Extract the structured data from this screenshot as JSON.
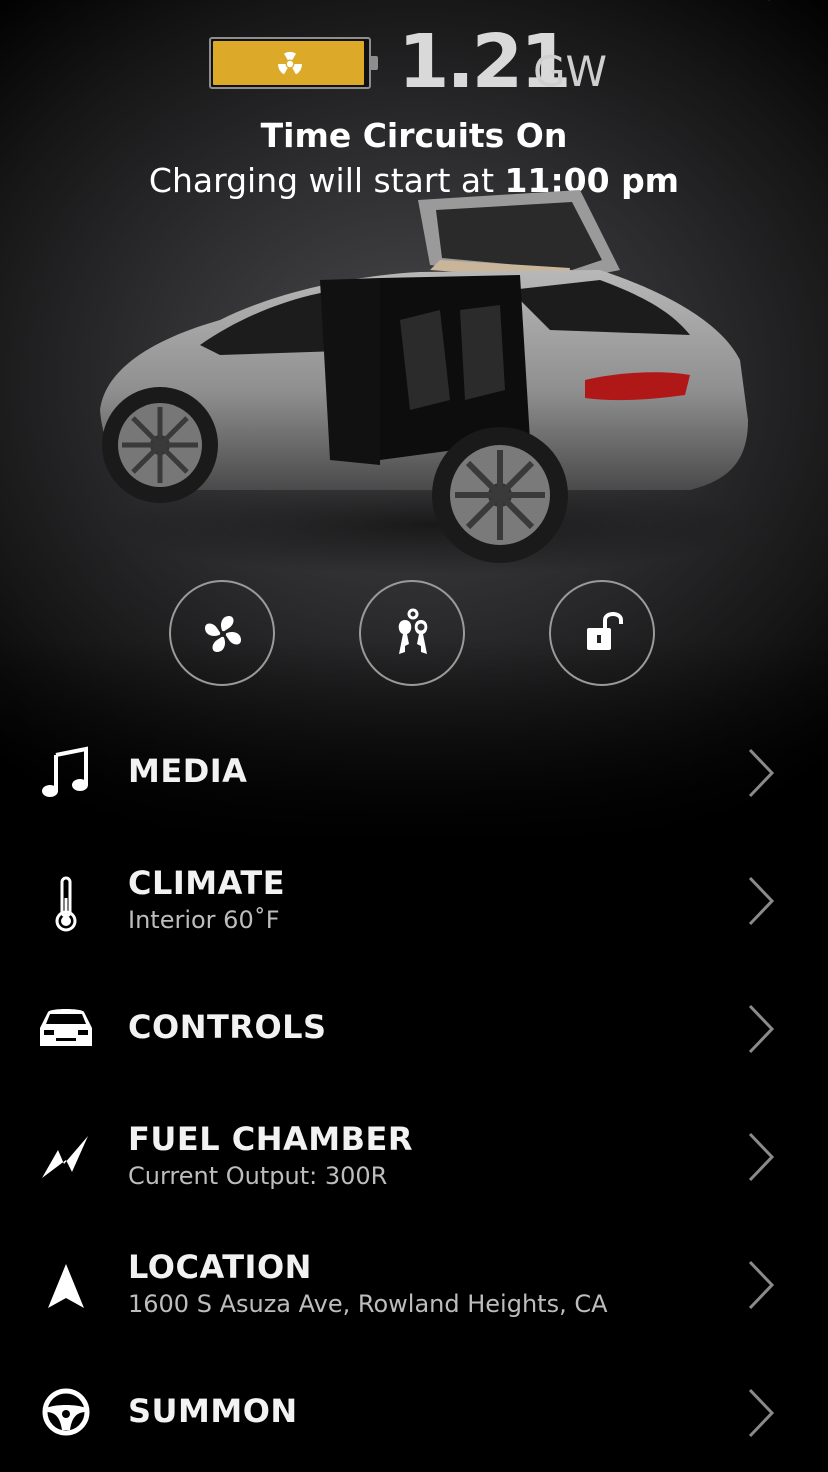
{
  "header": {
    "battery_level_fraction": 0.98,
    "battery_color": "#dcaa28",
    "battery_icon": "radiation-icon",
    "output_value": "1.21",
    "output_unit": "GW",
    "status_title": "Time Circuits On",
    "charging_prefix": "Charging will start at ",
    "charging_time": "11:00 pm"
  },
  "vehicle": {
    "image": "car-falcon-doors-open"
  },
  "quick_actions": [
    {
      "icon": "fan-icon"
    },
    {
      "icon": "keys-icon"
    },
    {
      "icon": "unlock-icon"
    }
  ],
  "menu": [
    {
      "icon": "music-note-icon",
      "label": "MEDIA",
      "subtitle": ""
    },
    {
      "icon": "thermometer-icon",
      "label": "CLIMATE",
      "subtitle": "Interior 60˚F"
    },
    {
      "icon": "car-front-icon",
      "label": "CONTROLS",
      "subtitle": ""
    },
    {
      "icon": "bolt-icon",
      "label": "FUEL CHAMBER",
      "subtitle": "Current Output: 300R"
    },
    {
      "icon": "navigation-arrow-icon",
      "label": "LOCATION",
      "subtitle": "1600 S Asuza Ave, Rowland Heights, CA"
    },
    {
      "icon": "steering-wheel-icon",
      "label": "SUMMON",
      "subtitle": ""
    }
  ]
}
